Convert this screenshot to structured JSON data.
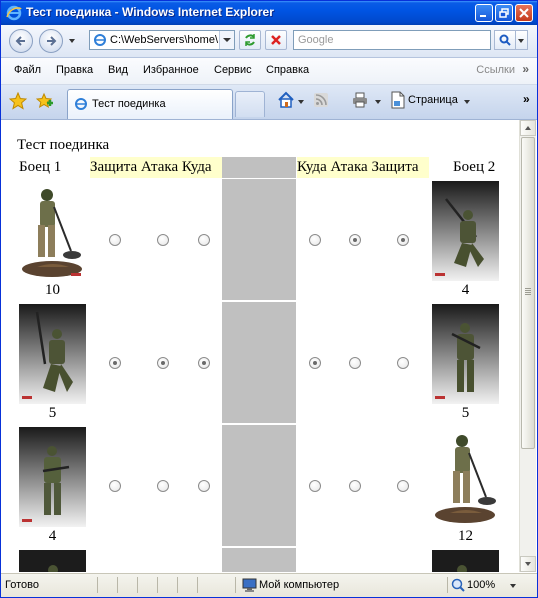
{
  "window": {
    "title": "Тест поединка - Windows Internet Explorer"
  },
  "address": {
    "url": "C:\\WebServers\\home\\"
  },
  "search": {
    "placeholder": "Google"
  },
  "menu": {
    "items": [
      {
        "label": "Файл"
      },
      {
        "label": "Правка"
      },
      {
        "label": "Вид"
      },
      {
        "label": "Избранное"
      },
      {
        "label": "Сервис"
      },
      {
        "label": "Справка"
      }
    ],
    "links_label": "Ссылки"
  },
  "tabs": {
    "active_label": "Тест поединка"
  },
  "commands": {
    "page_label": "Страница"
  },
  "page": {
    "heading": "Тест поединка",
    "fighter1_header": "Боец 1",
    "fighter2_header": "Боец 2",
    "left_headers": [
      "Защита",
      "Атака",
      "Куда"
    ],
    "right_headers": [
      "Куда",
      "Атака",
      "Защита"
    ],
    "rows": [
      {
        "left_value": "10",
        "right_value": "4",
        "left_radios": [
          false,
          false,
          false
        ],
        "right_radios": [
          false,
          true,
          true
        ]
      },
      {
        "left_value": "5",
        "right_value": "5",
        "left_radios": [
          true,
          true,
          true
        ],
        "right_radios": [
          true,
          false,
          false
        ]
      },
      {
        "left_value": "4",
        "right_value": "12",
        "left_radios": [
          false,
          false,
          false
        ],
        "right_radios": [
          false,
          false,
          false
        ]
      }
    ]
  },
  "statusbar": {
    "status": "Готово",
    "zone": "Мой компьютер",
    "zoom": "100%"
  },
  "colors": {
    "title_bar": "#0054e3",
    "header_highlight": "#ffffcc",
    "middle_column": "#c0c0c0"
  }
}
